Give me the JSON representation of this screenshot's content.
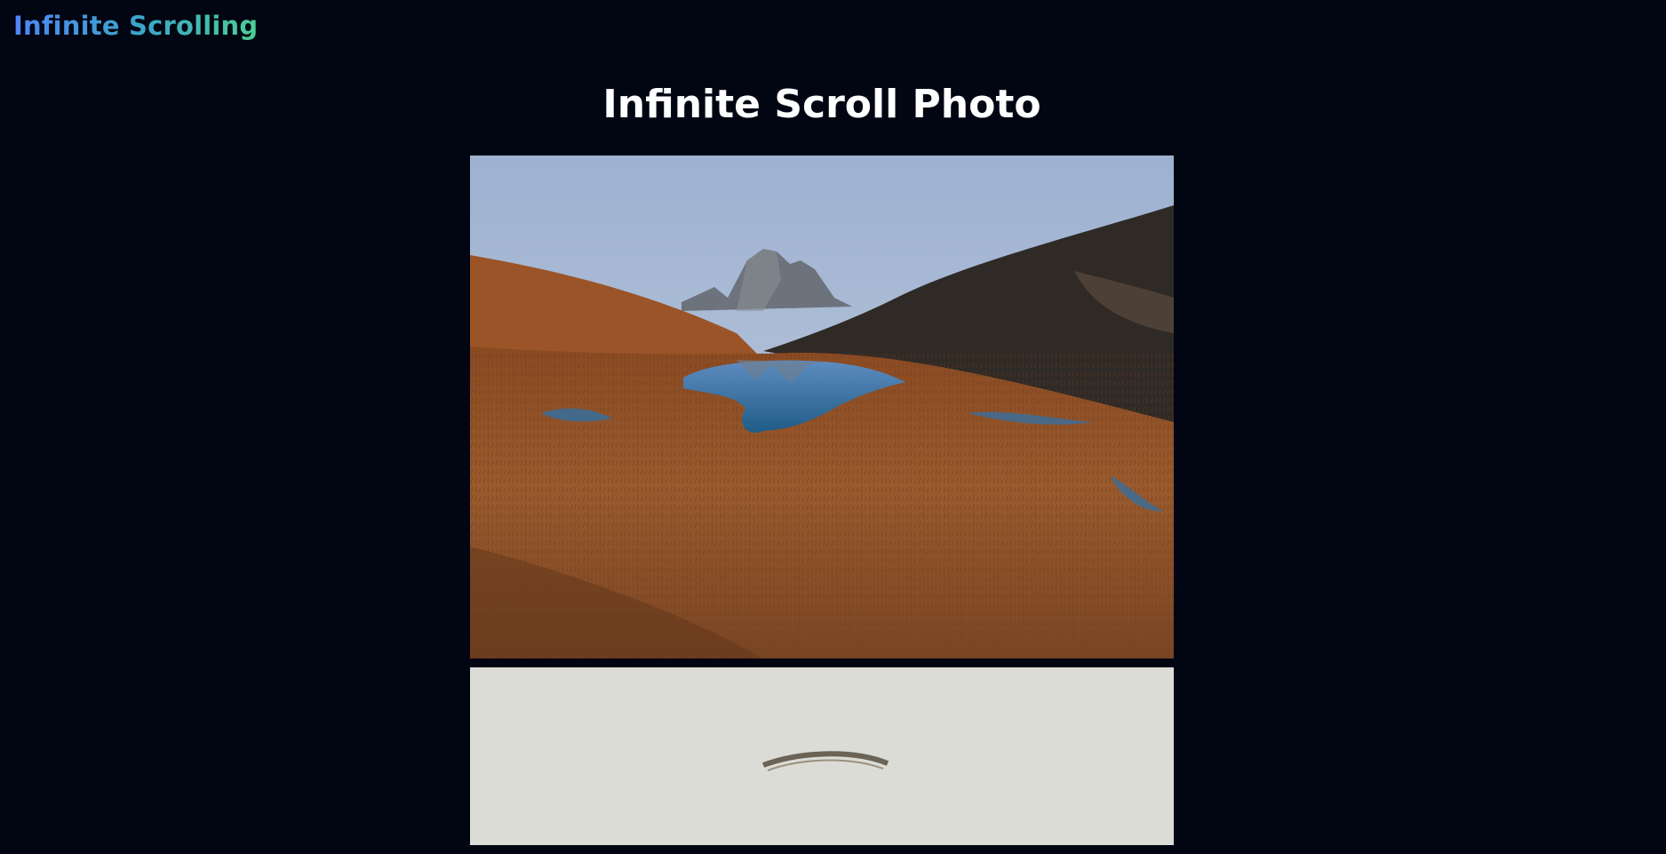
{
  "header": {
    "brand": "Infinite Scrolling"
  },
  "main": {
    "title": "Infinite Scroll Photo"
  },
  "feed": {
    "photos": [
      {
        "subject": "mountain-lake-landscape"
      },
      {
        "subject": "arched-object-light-background"
      }
    ]
  },
  "colors": {
    "background": "#020612",
    "brand_gradient_start": "#4f86f7",
    "brand_gradient_end": "#4ccf95",
    "title": "#ffffff"
  }
}
